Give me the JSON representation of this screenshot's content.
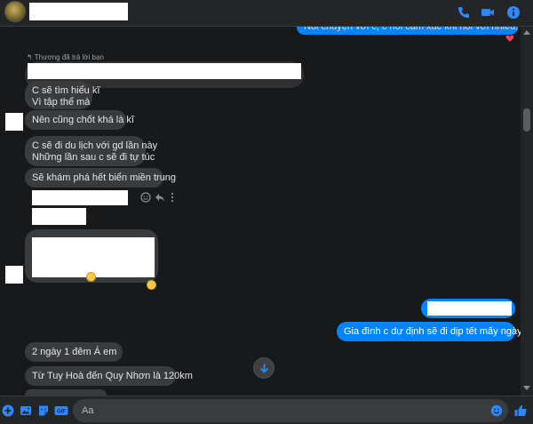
{
  "header": {
    "icons": [
      "phone-icon",
      "video-call-icon",
      "info-icon"
    ],
    "accent_color": "#0084ff"
  },
  "messages": {
    "partial_out": "Nói chuyện với c, c nói cảm xúc khi nói với nhiều, nóng",
    "reply_label": "Thương đã trả lời bạn",
    "m1_line1": "C sẽ tìm hiểu kĩ",
    "m1_line2": "Vì tập thể mà",
    "m2": "Nên cũng chốt khá là kĩ",
    "m3_line1": "C sẽ đi du lịch với gd lần này",
    "m3_line2": "Những lần sau c sẽ đi tự túc",
    "m4": "Sẽ khám phá hết biển miền trung",
    "out2": "Gia đình c dự định sẽ đi dịp tết mấy ngày á c",
    "m5": "2 ngày 1 đêm Á em",
    "m6": "Từ Tuy Hoà đến Quy Nhơn là 120km"
  },
  "composer": {
    "placeholder": "Aa",
    "icons": [
      "plus-icon",
      "image-icon",
      "sticker-icon",
      "gif-icon",
      "emoji-icon",
      "like-icon"
    ]
  }
}
